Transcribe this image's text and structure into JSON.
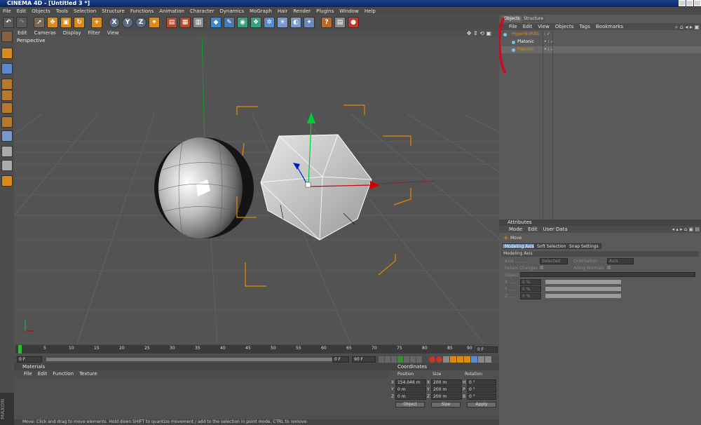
{
  "window": {
    "title": "CINEMA 4D - [Untitled 3 *]"
  },
  "menu": [
    "File",
    "Edit",
    "Objects",
    "Tools",
    "Selection",
    "Structure",
    "Functions",
    "Animation",
    "Character",
    "Dynamics",
    "MoGraph",
    "Hair",
    "Render",
    "Plugins",
    "Window",
    "Help"
  ],
  "toolbar": {
    "axis_labels": [
      "X",
      "Y",
      "Z"
    ]
  },
  "viewport": {
    "menu": [
      "Edit",
      "Cameras",
      "Display",
      "Filter",
      "View"
    ],
    "label": "Perspective"
  },
  "timeline": {
    "ticks": [
      "0",
      "5",
      "10",
      "15",
      "20",
      "25",
      "30",
      "35",
      "40",
      "45",
      "50",
      "55",
      "60",
      "65",
      "70",
      "75",
      "80",
      "85",
      "90"
    ],
    "frame_display": "0 F",
    "start": "0 F",
    "current": "0 F",
    "end": "90 F"
  },
  "materials": {
    "title": "Materials",
    "menu": [
      "File",
      "Edit",
      "Function",
      "Texture"
    ]
  },
  "coordinates": {
    "title": "Coordinates",
    "headers": [
      "Position",
      "Size",
      "Rotation"
    ],
    "rows": [
      {
        "axis": "X",
        "pos": "154.046 m",
        "saxis": "X",
        "size": "200 m",
        "raxis": "H",
        "rot": "0 °"
      },
      {
        "axis": "Y",
        "pos": "0 m",
        "saxis": "Y",
        "size": "200 m",
        "raxis": "P",
        "rot": "0 °"
      },
      {
        "axis": "Z",
        "pos": "0 m",
        "saxis": "Z",
        "size": "200 m",
        "raxis": "B",
        "rot": "0 °"
      }
    ],
    "mode_select": "Object",
    "size_select": "Size",
    "apply": "Apply"
  },
  "objects": {
    "tabs": [
      "Objects",
      "Structure"
    ],
    "menu": [
      "File",
      "Edit",
      "View",
      "Objects",
      "Tags",
      "Bookmarks"
    ],
    "items": [
      {
        "name": "HyperNURBS",
        "indent": 0
      },
      {
        "name": "Platonic",
        "indent": 1
      },
      {
        "name": "Platonic",
        "indent": 1
      }
    ]
  },
  "attributes": {
    "title": "Attributes",
    "menu": [
      "Mode",
      "Edit",
      "User Data"
    ],
    "tool": "Move",
    "tabs": [
      "Modeling Axis",
      "Soft Selection",
      "Snap Settings"
    ],
    "section": "Modeling Axis",
    "axis_label": "Axis .........",
    "axis_value": "Selected",
    "orientation_label": "Orientation ....",
    "orientation_value": "Axis",
    "retain_label": "Retain Changes",
    "normals_label": "Along Normals",
    "object_label": "Object",
    "x_label": "X .....",
    "x_val": "0 %",
    "y_label": "Y .....",
    "y_val": "0 %",
    "z_label": "Z .....",
    "z_val": "0 %"
  },
  "status": "Move: Click and drag to move elements. Hold down SHIFT to quantize movement / add to the selection in point mode, CTRL to remove.",
  "colors": {
    "accent_orange": "#e08a00",
    "annotation_red": "#c0102a",
    "axis_green": "#00cc33",
    "axis_red": "#cc0000",
    "axis_blue": "#0022cc"
  }
}
